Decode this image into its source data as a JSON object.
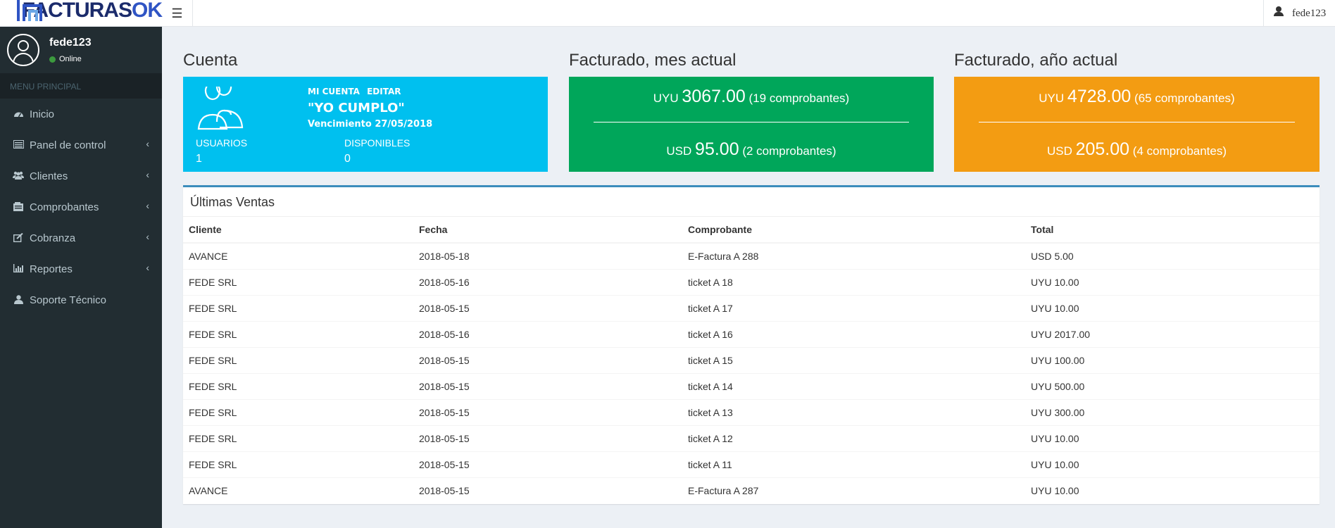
{
  "header": {
    "logo_part1": "FACTURAS",
    "logo_part2": "OK",
    "username": "fede123"
  },
  "sidebar": {
    "user": {
      "name": "fede123",
      "status": "Online"
    },
    "menu_header": "MENU PRINCIPAL",
    "items": [
      {
        "label": "Inicio",
        "icon": "dashboard-icon",
        "has_chevron": false
      },
      {
        "label": "Panel de control",
        "icon": "list-icon",
        "has_chevron": true
      },
      {
        "label": "Clientes",
        "icon": "users-icon",
        "has_chevron": true
      },
      {
        "label": "Comprobantes",
        "icon": "folder-icon",
        "has_chevron": true
      },
      {
        "label": "Cobranza",
        "icon": "edit-icon",
        "has_chevron": true
      },
      {
        "label": "Reportes",
        "icon": "bar-chart-icon",
        "has_chevron": true
      },
      {
        "label": "Soporte Técnico",
        "icon": "user-icon",
        "has_chevron": false
      }
    ]
  },
  "account": {
    "title": "Cuenta",
    "link_account": "MI CUENTA",
    "link_edit": "EDITAR",
    "name": "\"YO CUMPLO\"",
    "due": "Vencimiento 27/05/2018",
    "users_label": "USUARIOS",
    "users_value": "1",
    "available_label": "DISPONIBLES",
    "available_value": "0",
    "color": "#00c0ef"
  },
  "month": {
    "title": "Facturado, mes actual",
    "line1": {
      "currency": "UYU",
      "amount": "3067.00",
      "count": "(19 comprobantes)"
    },
    "line2": {
      "currency": "USD",
      "amount": "95.00",
      "count": "(2 comprobantes)"
    },
    "color": "#00a65a"
  },
  "year": {
    "title": "Facturado, año actual",
    "line1": {
      "currency": "UYU",
      "amount": "4728.00",
      "count": "(65 comprobantes)"
    },
    "line2": {
      "currency": "USD",
      "amount": "205.00",
      "count": "(4 comprobantes)"
    },
    "color": "#f39c12"
  },
  "sales": {
    "title": "Últimas Ventas",
    "columns": [
      "Cliente",
      "Fecha",
      "Comprobante",
      "Total"
    ],
    "rows": [
      [
        "AVANCE",
        "2018-05-18",
        "E-Factura A 288",
        "USD 5.00"
      ],
      [
        "FEDE SRL",
        "2018-05-16",
        "ticket A 18",
        "UYU 10.00"
      ],
      [
        "FEDE SRL",
        "2018-05-15",
        "ticket A 17",
        "UYU 10.00"
      ],
      [
        "FEDE SRL",
        "2018-05-16",
        "ticket A 16",
        "UYU 2017.00"
      ],
      [
        "FEDE SRL",
        "2018-05-15",
        "ticket A 15",
        "UYU 100.00"
      ],
      [
        "FEDE SRL",
        "2018-05-15",
        "ticket A 14",
        "UYU 500.00"
      ],
      [
        "FEDE SRL",
        "2018-05-15",
        "ticket A 13",
        "UYU 300.00"
      ],
      [
        "FEDE SRL",
        "2018-05-15",
        "ticket A 12",
        "UYU 10.00"
      ],
      [
        "FEDE SRL",
        "2018-05-15",
        "ticket A 11",
        "UYU 10.00"
      ],
      [
        "AVANCE",
        "2018-05-15",
        "E-Factura A 287",
        "UYU 10.00"
      ]
    ]
  }
}
